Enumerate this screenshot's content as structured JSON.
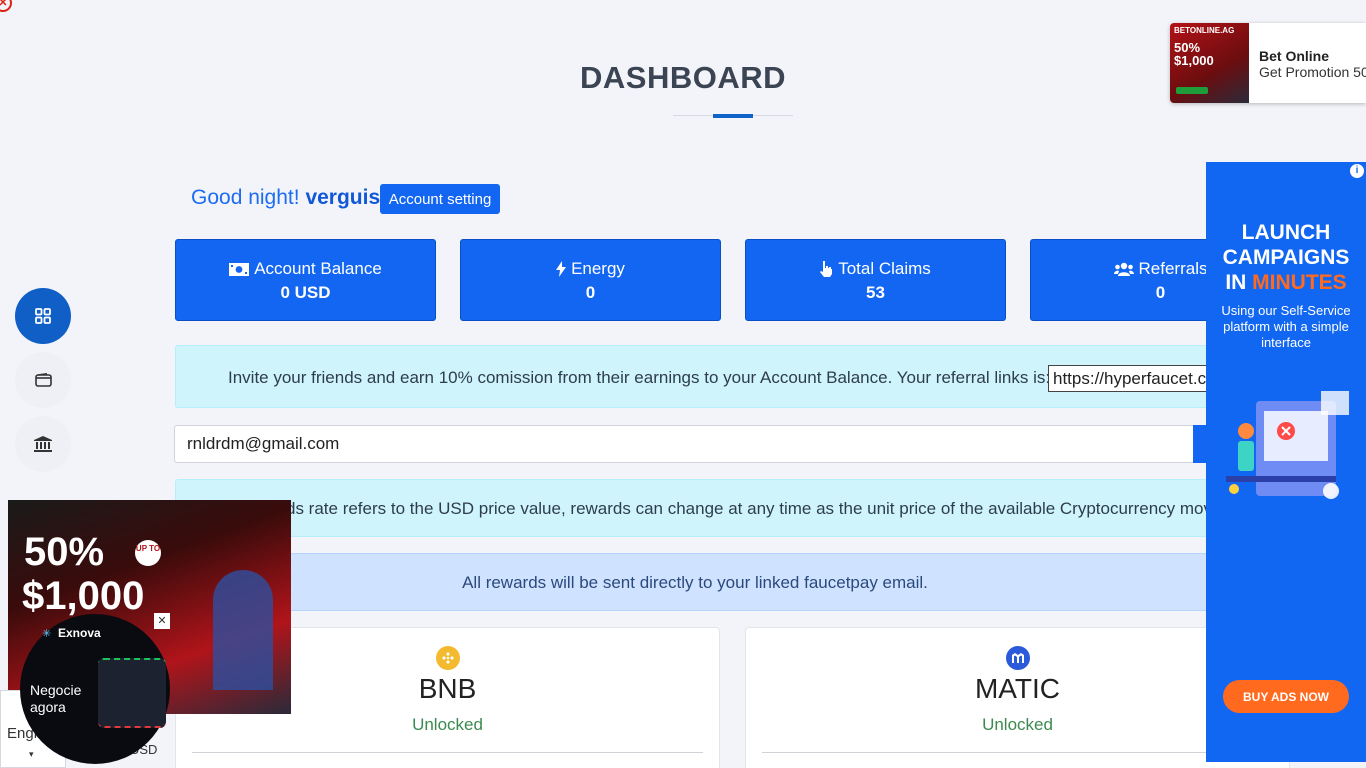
{
  "page": {
    "title": "DASHBOARD",
    "greeting": "Good night!",
    "username": "verguis",
    "account_setting_label": "Account setting"
  },
  "stats": [
    {
      "icon": "money-bill-icon",
      "label": "Account Balance",
      "value": "0 USD"
    },
    {
      "icon": "bolt-icon",
      "label": "Energy",
      "value": "0"
    },
    {
      "icon": "hand-pointer-icon",
      "label": "Total Claims",
      "value": "53"
    },
    {
      "icon": "users-icon",
      "label": "Referrals",
      "value": "0"
    }
  ],
  "invite": {
    "text": "Invite your friends and earn 10% comission from their earnings to your Account Balance. Your referral links is:",
    "link_value": "https://hyperfaucet.com/?r=verguis"
  },
  "email": {
    "value": "rnldrdm@gmail.com"
  },
  "rate_notice": "ds rate refers to the USD price value, rewards can change at any time as the unit price of the available Cryptocurrency moves.",
  "rewards_notice": "All rewards will be sent directly to your linked faucetpay email.",
  "coins": [
    {
      "name": "BNB",
      "status": "Unlocked",
      "icon": "bnb-coin-icon",
      "color": "#f3ba2f"
    },
    {
      "name": "MATIC",
      "status": "Unlocked",
      "icon": "matic-coin-icon",
      "color": "#2a5ada"
    }
  ],
  "sidebar": {
    "items": [
      {
        "icon": "dashboard-grid-icon",
        "active": true
      },
      {
        "icon": "wallet-icon",
        "active": false
      },
      {
        "icon": "bank-icon",
        "active": false
      }
    ]
  },
  "ads": {
    "top_right": {
      "brand": "BETONLINE.AG",
      "title": "Bet Online",
      "subtitle": "Get Promotion 50",
      "promo_pct": "50%",
      "promo_amount": "$1,000"
    },
    "right": {
      "line1": "LAUNCH",
      "line2": "CAMPAIGNS",
      "line3_a": "IN ",
      "line3_b": "MINUTES",
      "body": "Using our Self-Service platform with a simple interface",
      "button": "BUY ADS NOW"
    },
    "left": {
      "promo_pct": "50%",
      "promo_upto": "UP TO",
      "promo_amount": "$1,000",
      "exnova_brand": "Exnova",
      "exnova_cta": "Negocie agora"
    },
    "lang_label": "Engl",
    "usd_label": "USD"
  },
  "colors": {
    "primary": "#1266f1",
    "info_bg": "#cff4fc",
    "notice_bg": "#cfe2ff",
    "ad_blue": "#1267f2",
    "ad_orange": "#ff6a1f"
  }
}
